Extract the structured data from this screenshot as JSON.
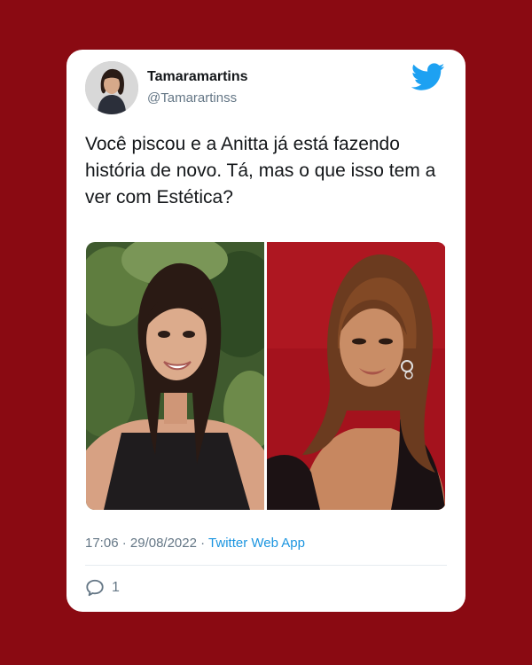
{
  "colors": {
    "background": "#8a0a12",
    "card": "#ffffff",
    "twitter_blue": "#1da1f2",
    "link": "#1b95e0",
    "muted": "#657786",
    "text": "#14171a"
  },
  "tweet": {
    "display_name": "Tamaramartins",
    "handle": "@Tamarartinss",
    "text": "Você piscou e a Anitta já está fazendo história de novo. Tá, mas o que isso tem a ver com Estética?",
    "time": "17:06",
    "separator": "·",
    "date": "29/08/2022",
    "source": "Twitter Web App",
    "reply_count": "1"
  },
  "icons": {
    "logo": "twitter-bird-icon",
    "reply": "speech-bubble-icon"
  }
}
